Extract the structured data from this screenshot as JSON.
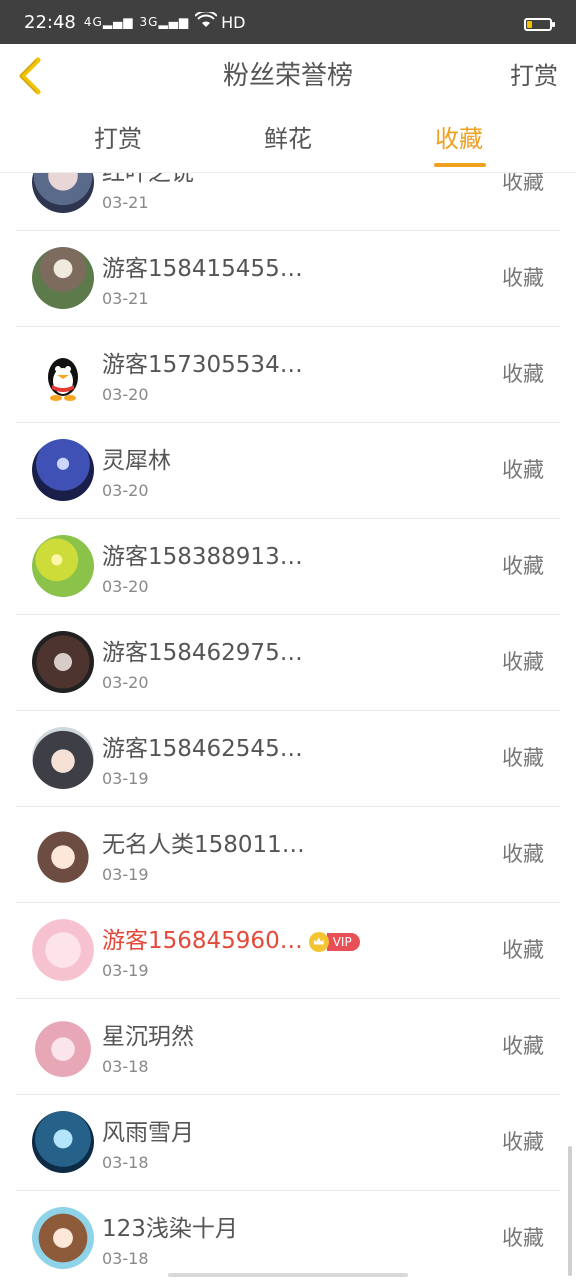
{
  "status_bar": {
    "time": "22:48",
    "signal1": "4G",
    "signal2": "3G",
    "network": "HD"
  },
  "header": {
    "title": "粉丝荣誉榜",
    "right_action": "打赏"
  },
  "tabs": [
    {
      "label": "打赏",
      "active": false
    },
    {
      "label": "鲜花",
      "active": false
    },
    {
      "label": "收藏",
      "active": true
    }
  ],
  "colors": {
    "accent": "#f0a11e",
    "vip_name": "#e4493a",
    "vip_badge": "#e84f57"
  },
  "rows": [
    {
      "name": "红叶之说",
      "date": "03-21",
      "action": "收藏",
      "avatar": "girl-avatar"
    },
    {
      "name": "游客158415455…",
      "date": "03-21",
      "action": "收藏",
      "avatar": "photo-avatar"
    },
    {
      "name": "游客157305534…",
      "date": "03-20",
      "action": "收藏",
      "avatar": "penguin-avatar"
    },
    {
      "name": "灵犀林",
      "date": "03-20",
      "action": "收藏",
      "avatar": "night-sky-avatar"
    },
    {
      "name": "游客158388913…",
      "date": "03-20",
      "action": "收藏",
      "avatar": "flowers-avatar"
    },
    {
      "name": "游客158462975…",
      "date": "03-20",
      "action": "收藏",
      "avatar": "dogs-avatar"
    },
    {
      "name": "游客158462545…",
      "date": "03-19",
      "action": "收藏",
      "avatar": "anime-boy-avatar"
    },
    {
      "name": "无名人类158011…",
      "date": "03-19",
      "action": "收藏",
      "avatar": "cartoon-girl-avatar"
    },
    {
      "name": "游客156845960…",
      "date": "03-19",
      "action": "收藏",
      "avatar": "pink-anime-avatar",
      "vip": "VIP"
    },
    {
      "name": "星沉玥然",
      "date": "03-18",
      "action": "收藏",
      "avatar": "hat-girl-avatar"
    },
    {
      "name": "风雨雪月",
      "date": "03-18",
      "action": "收藏",
      "avatar": "blue-anime-avatar"
    },
    {
      "name": "123浅染十月",
      "date": "03-18",
      "action": "收藏",
      "avatar": "brown-hair-avatar"
    }
  ]
}
